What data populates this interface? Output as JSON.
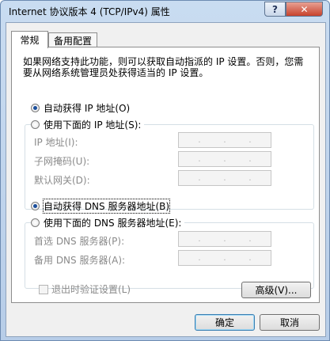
{
  "window": {
    "title": "Internet 协议版本 4 (TCP/IPv4) 属性",
    "help_label": "?",
    "close_label": "✕"
  },
  "tabs": [
    {
      "label": "常规",
      "active": true
    },
    {
      "label": "备用配置",
      "active": false
    }
  ],
  "description": "如果网络支持此功能，则可以获取自动指派的 IP 设置。否则，您需要从网络系统管理员处获得适当的 IP 设置。",
  "ip": {
    "auto_label": "自动获得 IP 地址(O)",
    "manual_label": "使用下面的 IP 地址(S):",
    "selected": "auto",
    "fields": [
      {
        "label": "IP 地址(I):",
        "value": ""
      },
      {
        "label": "子网掩码(U):",
        "value": ""
      },
      {
        "label": "默认网关(D):",
        "value": ""
      }
    ]
  },
  "dns": {
    "auto_label": "自动获得 DNS 服务器地址(B)",
    "manual_label": "使用下面的 DNS 服务器地址(E):",
    "selected": "auto",
    "fields": [
      {
        "label": "首选 DNS 服务器(P):",
        "value": ""
      },
      {
        "label": "备用 DNS 服务器(A):",
        "value": ""
      }
    ]
  },
  "validate_label": "退出时验证设置(L)",
  "advanced_label": "高级(V)...",
  "ok_label": "确定",
  "cancel_label": "取消",
  "ip_dots": [
    ".",
    ".",
    "."
  ]
}
